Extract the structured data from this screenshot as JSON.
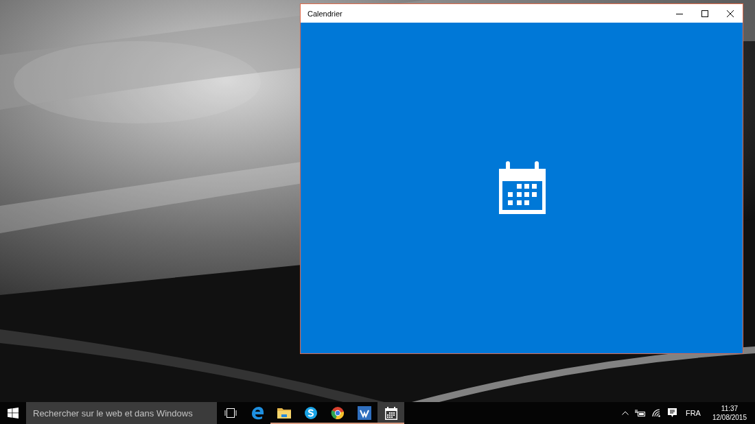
{
  "window": {
    "title": "Calendrier"
  },
  "taskbar": {
    "search": {
      "placeholder": "Rechercher sur le web et dans Windows"
    },
    "apps": [
      {
        "kind": "edge",
        "running": false,
        "selected": false
      },
      {
        "kind": "folder",
        "running": true,
        "selected": false
      },
      {
        "kind": "skype",
        "running": true,
        "selected": false
      },
      {
        "kind": "chrome",
        "running": true,
        "selected": false
      },
      {
        "kind": "writer",
        "running": true,
        "selected": false
      },
      {
        "kind": "calendar",
        "running": true,
        "selected": true
      }
    ],
    "tray": {
      "language": "FRA",
      "time": "11:37",
      "date": "12/08/2015"
    }
  }
}
